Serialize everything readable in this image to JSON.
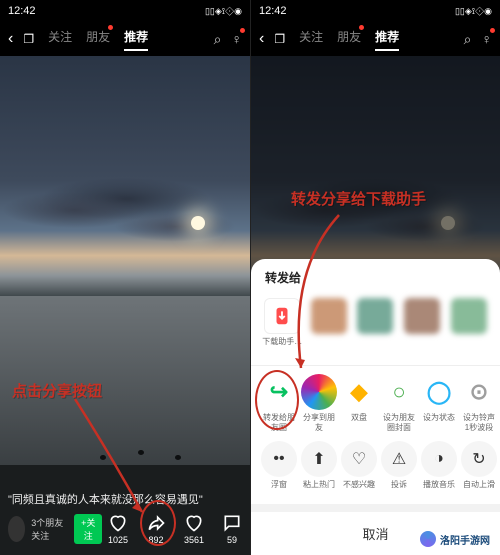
{
  "status": {
    "time": "12:42",
    "icons": "▯▯◈⟟⟐◉"
  },
  "topnav": {
    "back_glyph": "‹",
    "tabs": [
      "关注",
      "朋友",
      "推荐"
    ],
    "active_index": 2
  },
  "left": {
    "annotation_text": "点击分享按钮",
    "caption": "\"同频且真诚的人本来就没那么容易遇见\"",
    "friends_follow": "3个朋友关注",
    "follow_btn": "+关注",
    "like_icon_desc": "heart-outline",
    "like_count": "1025",
    "share_icon_desc": "share-arrow",
    "share_count": "892",
    "fav_icon_desc": "heart-outline",
    "fav_count": "3561",
    "comment_icon_desc": "speech-bubble",
    "comment_count": "59"
  },
  "right": {
    "annotation_text": "转发分享给下载助手",
    "sheet_title": "转发给",
    "first_contact_name": "下载助手…",
    "row1": [
      {
        "name": "forward-friends",
        "label": "转发给朋友圈",
        "color": "#07c160",
        "glyph": "↪"
      },
      {
        "name": "share-friend",
        "label": "分享到朋友",
        "color_bg": "conic",
        "glyph": "✱"
      },
      {
        "name": "shuangsè",
        "label": "双盘",
        "color": "#ffb300",
        "glyph": "◆"
      },
      {
        "name": "set-cover",
        "label": "设为朋友圈封面",
        "color": "#4caf50",
        "glyph": "○"
      },
      {
        "name": "set-status",
        "label": "设为状态",
        "color": "#29b6f6",
        "glyph": "◯"
      },
      {
        "name": "ringtone",
        "label": "设为铃声 1秒波段",
        "color": "#9e9e9e",
        "glyph": "⊙"
      }
    ],
    "row2": [
      {
        "name": "more",
        "label": "浮窗",
        "glyph": "••"
      },
      {
        "name": "hot",
        "label": "粘上热门",
        "glyph": "⬆"
      },
      {
        "name": "dislike",
        "label": "不感兴趣",
        "glyph": "♡"
      },
      {
        "name": "report",
        "label": "投诉",
        "glyph": "⚠"
      },
      {
        "name": "play-music",
        "label": "播放音乐",
        "glyph": "◑"
      },
      {
        "name": "auto-play",
        "label": "自动上滑",
        "glyph": "↻"
      }
    ],
    "cancel": "取消"
  },
  "watermark": "洛阳手游网"
}
